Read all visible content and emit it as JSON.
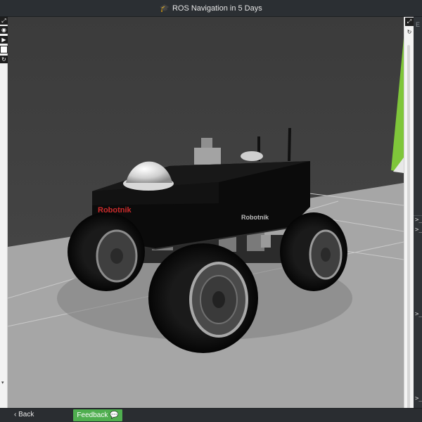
{
  "window": {
    "title": "ROS Navigation in 5 Days",
    "title_icon": "graduation-cap-icon"
  },
  "left_toolbar": {
    "icons": [
      "expand-icon",
      "eye-icon",
      "step-forward-icon",
      "stop-icon",
      "refresh-icon"
    ],
    "collapse_glyph": "▾"
  },
  "right_toolbar": {
    "icons": [
      "expand-icon",
      "refresh-icon"
    ]
  },
  "editor_panel": {
    "label": "E",
    "prompts": [
      ">_",
      ">_",
      ">_",
      ">_"
    ]
  },
  "scene": {
    "robot_logo_front": "Robotnik",
    "robot_logo_side": "Robotnik",
    "colors": {
      "background": "#414141",
      "floor": "#a6a6a6",
      "green_panel": "#7fc63a"
    }
  },
  "footer": {
    "back_label": "Back",
    "feedback_label": "Feedback",
    "feedback_color": "#4fae4f"
  }
}
